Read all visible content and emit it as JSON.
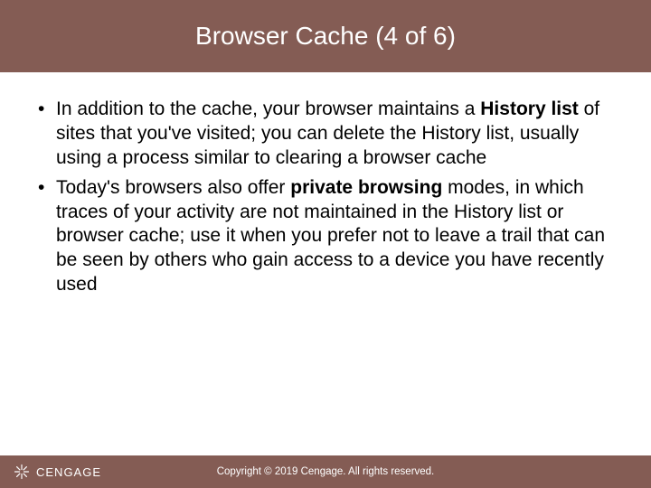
{
  "title": "Browser Cache (4 of 6)",
  "bullets": [
    {
      "pre": "In addition to the cache, your browser maintains a ",
      "bold": "History list",
      "post": " of sites that you've visited; you can delete the History list, usually using a process similar to clearing a browser cache"
    },
    {
      "pre": "Today's browsers also offer ",
      "bold": "private browsing",
      "post": " modes, in which traces of your activity are not maintained in the History list or browser cache; use it when you prefer not to leave a trail that can be seen by others who gain access to a device you have recently used"
    }
  ],
  "footer": {
    "brand": "CENGAGE",
    "copyright": "Copyright © 2019 Cengage. All rights reserved."
  }
}
